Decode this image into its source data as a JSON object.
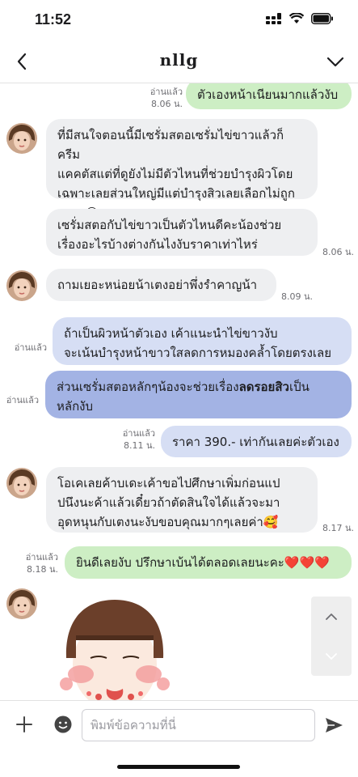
{
  "status_bar": {
    "time": "11:52"
  },
  "header": {
    "title": "nllg"
  },
  "messages": [
    {
      "read": "อ่านแล้ว",
      "time": "8.06 น.",
      "text": "ตัวเองหน้าเนียนมากแล้วงับ"
    },
    {
      "lines": [
        "ที่มีสนใจตอนนี้มีเซรั่มสตอเซรั่มไข่ขาวแล้วก็ครีม",
        "แคคตัสแต่ที่ดูยังไม่มีตัวไหนที่ช่วยบำรุงผิวโดย",
        "เฉพาะเลยส่วนใหญ่มีแต่บำรุงสิวเลยเลือกไม่ถูก",
        "แฮะๆ😅"
      ]
    },
    {
      "lines": [
        "เซรั่มสตอกับไข่ขาวเป็นตัวไหนดีคะน้องช่วย",
        "เรื่องอะไรบ้างต่างกันไงงับราคาเท่าไหร่"
      ],
      "time": "8.06 น."
    },
    {
      "text": "ถามเยอะหน่อยน้าเตงอย่าพึ่งรำคาญน้า",
      "time": "8.09 น."
    },
    {
      "read": "อ่านแล้ว",
      "lines": [
        "ถ้าเป็นผิวหน้าตัวเอง เค้าแนะนำไข่ขาวงับ",
        "จะเน้นบำรุงหน้าขาวใสลดการหมองคล้ำโดยตรงเลย"
      ]
    },
    {
      "read": "อ่านแล้ว",
      "text_before": "ส่วนเซรั่มสตอหลักๆน้องจะช่วยเรื่อง",
      "text_bold": "ลดรอยสิว",
      "text_after": "เป็น",
      "line2": "หลักงับ"
    },
    {
      "read": "อ่านแล้ว",
      "time": "8.11 น.",
      "text": "ราคา 390.- เท่ากันเลยค่ะตัวเอง"
    },
    {
      "lines": [
        "โอเคเลยค้าบเดะเค้าขอไปศึกษาเพิ่มก่อนแป",
        "ปนึงนะค้าแล้วเดี๋ยวถ้าตัดสินใจได้แล้วจะมา",
        "อุดหนุนกับเตงนะงับขอบคุณมากๆเลยค่า🥰"
      ],
      "time": "8.17 น."
    },
    {
      "read": "อ่านแล้ว",
      "time": "8.18 น.",
      "text": "ยินดีเลยงับ ปรึกษาเบ้นได้ตลอดเลยนะคะ❤️❤️❤️"
    }
  ],
  "composer": {
    "placeholder": "พิมพ์ข้อความที่นี่"
  },
  "colors": {
    "incoming": "#eeeff1",
    "outgoing_green": "#cdeec4",
    "outgoing_blue": "#d6def4",
    "outgoing_blue_dark": "#a3b3e4",
    "accent": "#1d1d1f"
  },
  "icons": [
    "back-arrow-icon",
    "chevron-down-icon",
    "plus-icon",
    "emoji-icon",
    "send-icon",
    "arrow-up-icon",
    "arrow-down-icon"
  ]
}
